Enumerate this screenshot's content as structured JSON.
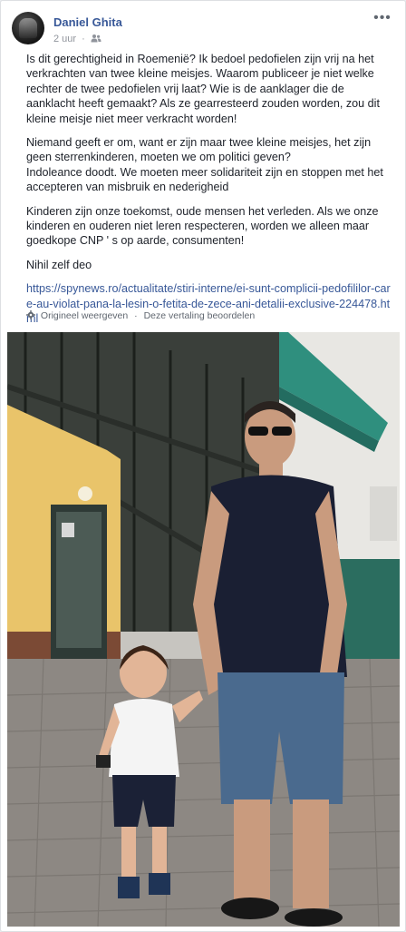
{
  "post": {
    "author": "Daniel Ghita",
    "time": "2 uur",
    "audience_icon": "friends-icon",
    "more_icon": "more-options-icon",
    "paragraphs": [
      "Is dit gerechtigheid in Roemenië? Ik bedoel pedofielen zijn vrij na het verkrachten van twee kleine meisjes. Waarom publiceer je niet welke rechter de twee pedofielen vrij laat? Wie is de aanklager die de aanklacht heeft gemaakt? Als ze gearresteerd zouden worden, zou dit kleine meisje niet meer verkracht worden!",
      "Niemand geeft er om, want er zijn maar twee kleine meisjes, het zijn geen sterrenkinderen, moeten we om politici geven?\nIndoleance doodt. We moeten meer solidariteit zijn en stoppen met het accepteren van misbruik en nederigheid",
      "Kinderen zijn onze toekomst, oude mensen het verleden. Als we onze kinderen en ouderen niet leren respecteren, worden we alleen maar goedkope CNP ' s op aarde, consumenten!",
      "Nihil zelf deo"
    ],
    "link": "https://spynews.ro/actualitate/stiri-interne/ei-sunt-complicii-pedofililor-care-au-violat-pana-la-lesin-o-fetita-de-zece-ani-detalii-exclusive-224478.html"
  },
  "translation": {
    "icon": "gear-icon",
    "show_original": "Origineel weergeven",
    "separator": "·",
    "rate": "Deze vertaling beoordelen"
  },
  "colors": {
    "link": "#385898",
    "meta": "#90949c",
    "text": "#1d2129"
  }
}
